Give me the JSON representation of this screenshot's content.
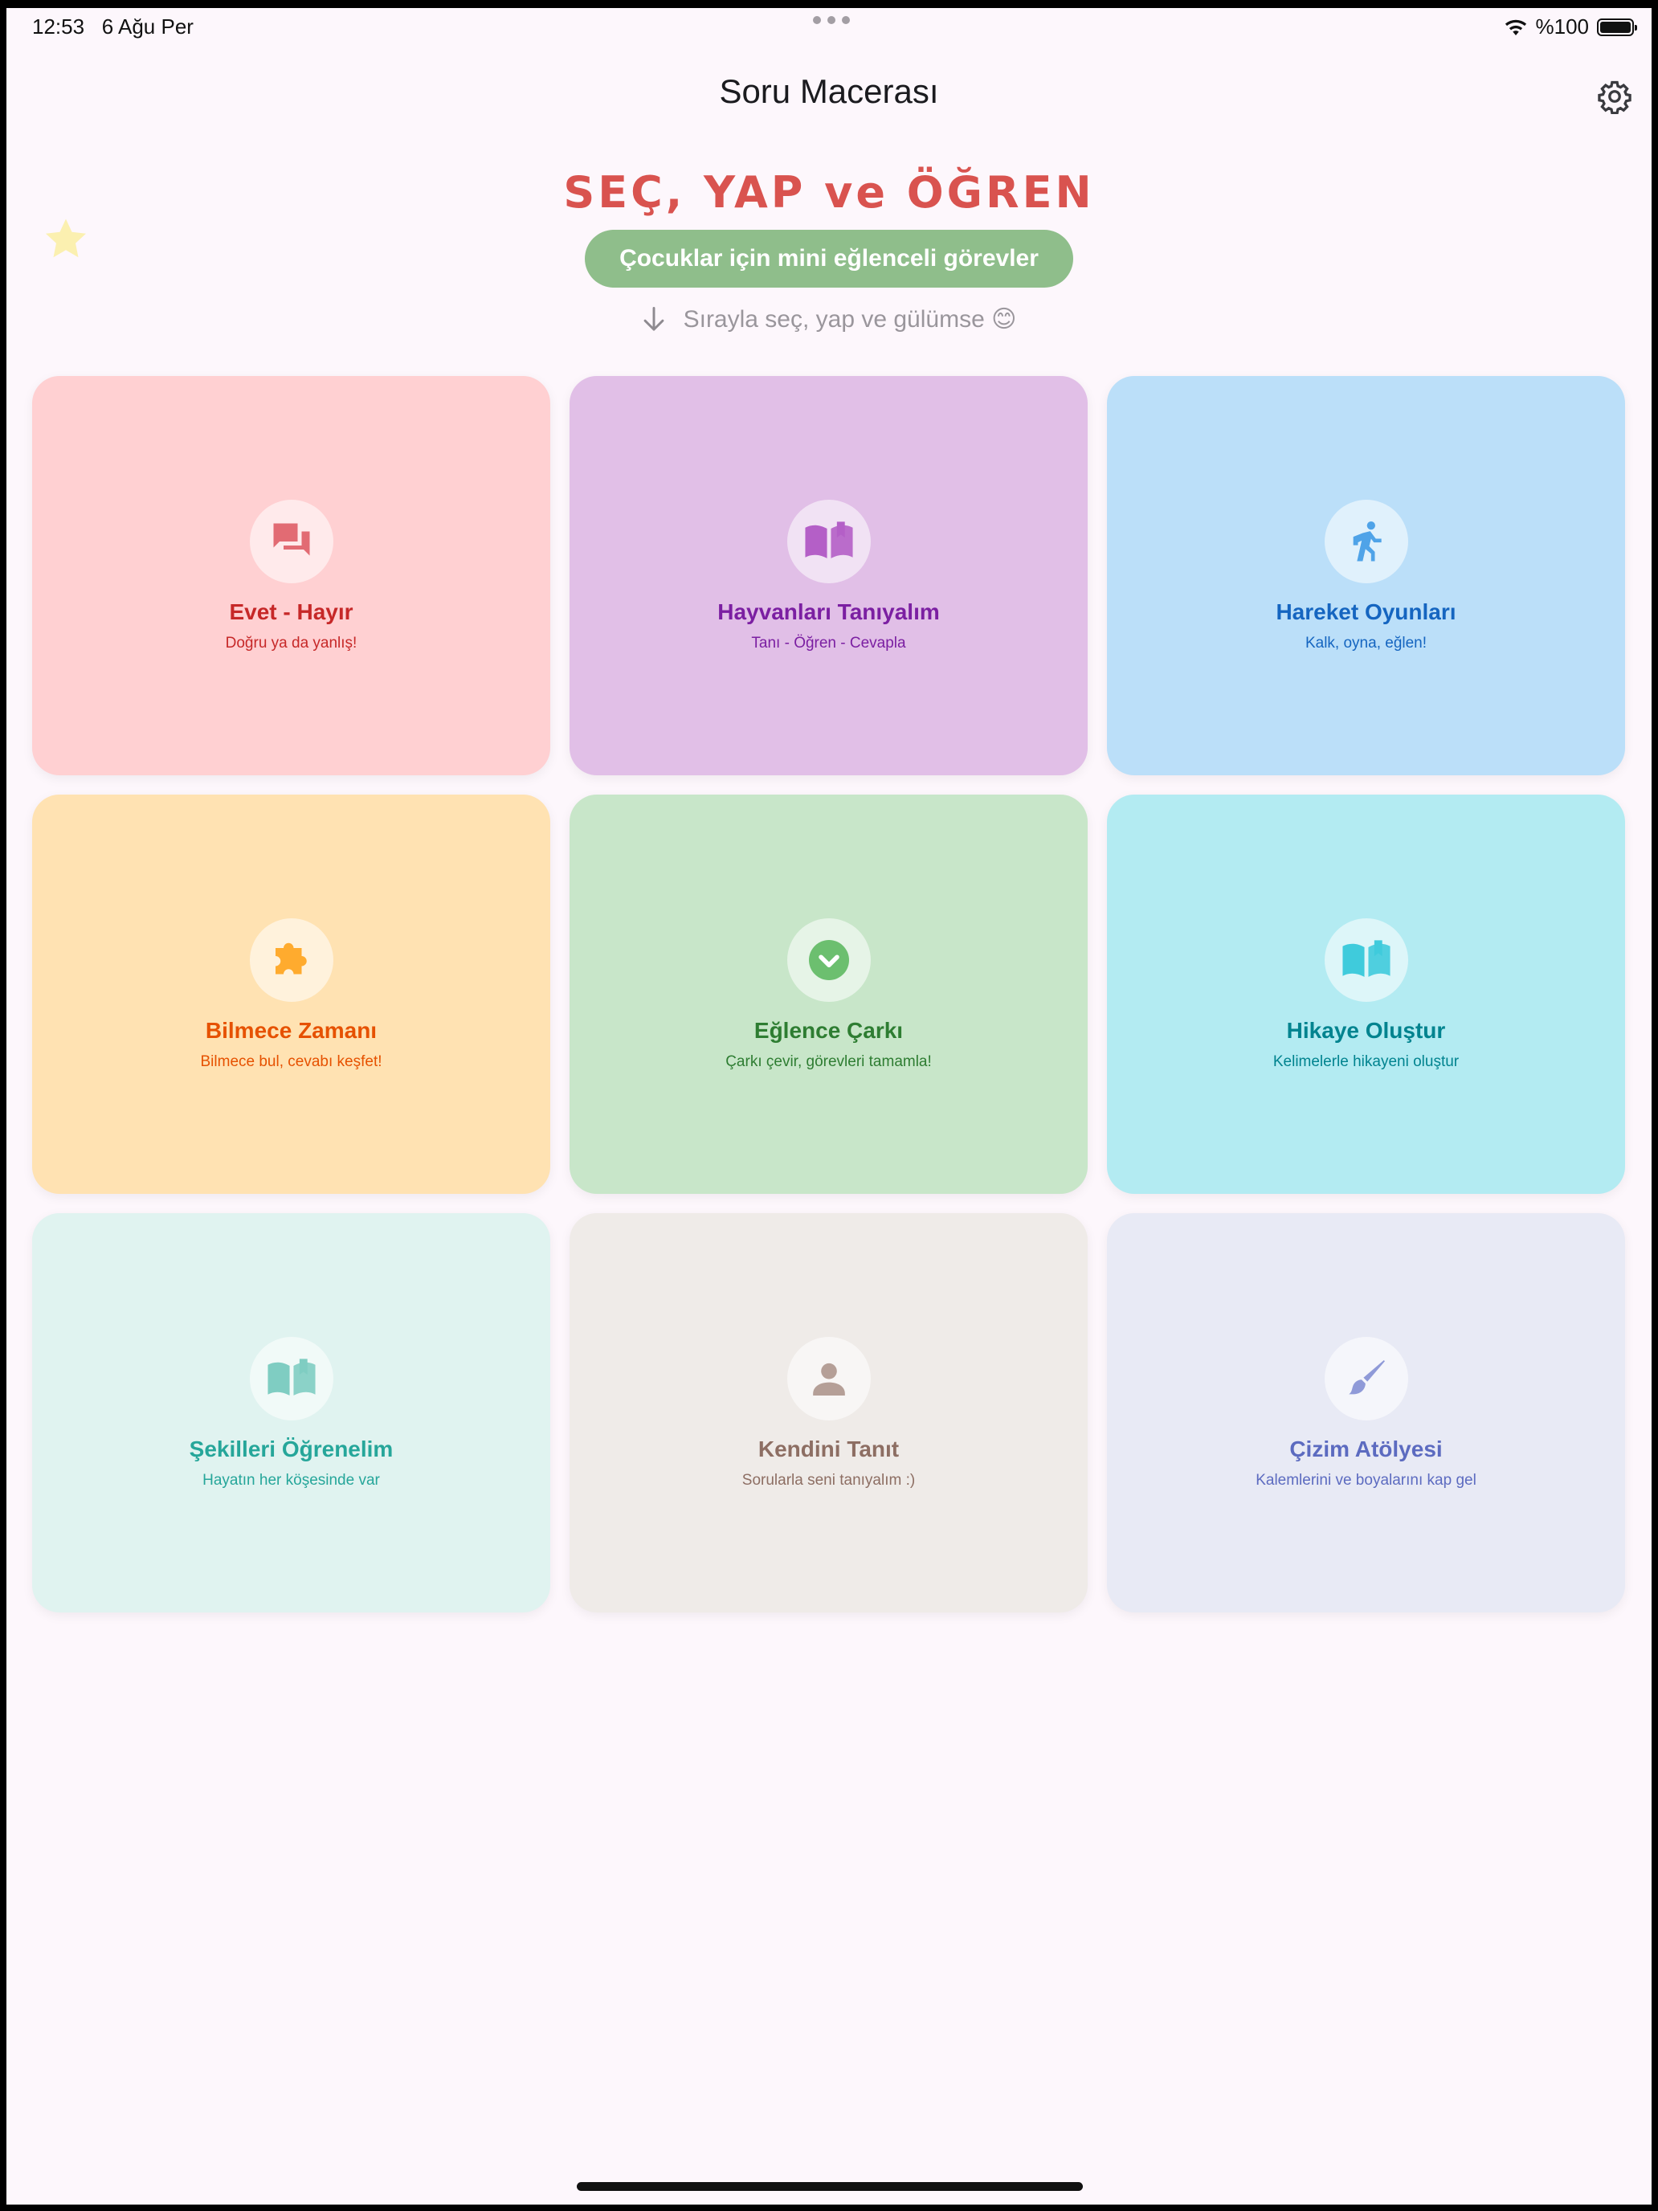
{
  "status": {
    "time": "12:53",
    "date": "6 Ağu Per",
    "battery": "%100"
  },
  "header": {
    "title": "Soru Macerası",
    "settings_icon": "gear-icon"
  },
  "hero": {
    "headline": "SEÇ, YAP ve ÖĞREN",
    "tagline": "Çocuklar için mini eğlenceli görevler",
    "hint": "Sırayla seç, yap ve gülümse 😊"
  },
  "cards": [
    {
      "title": "Evet - Hayır",
      "subtitle": "Doğru ya da yanlış!",
      "icon": "chat-bubbles-icon",
      "bg": "#ffd0d2",
      "fg": "#c62828",
      "icon_color": "#e26b73"
    },
    {
      "title": "Hayvanları Tanıyalım",
      "subtitle": "Tanı - Öğren - Cevapla",
      "icon": "book-icon",
      "bg": "#e1bfe7",
      "fg": "#7b1fa2",
      "icon_color": "#b45fc7"
    },
    {
      "title": "Hareket Oyunları",
      "subtitle": "Kalk, oyna, eğlen!",
      "icon": "running-icon",
      "bg": "#bbdff9",
      "fg": "#1565c0",
      "icon_color": "#4fa3e8"
    },
    {
      "title": "Bilmece Zamanı",
      "subtitle": "Bilmece bul, cevabı keşfet!",
      "icon": "puzzle-icon",
      "bg": "#ffe2b2",
      "fg": "#e65100",
      "icon_color": "#ffab2e"
    },
    {
      "title": "Eğlence Çarkı",
      "subtitle": "Çarkı çevir, görevleri tamamla!",
      "icon": "chevron-circle-icon",
      "bg": "#c8e6c9",
      "fg": "#2e7d32",
      "icon_color": "#6cbf6f"
    },
    {
      "title": "Hikaye Oluştur",
      "subtitle": "Kelimelerle hikayeni oluştur",
      "icon": "book-icon",
      "bg": "#b3ebf2",
      "fg": "#00838f",
      "icon_color": "#3fcbdc"
    },
    {
      "title": "Şekilleri Öğrenelim",
      "subtitle": "Hayatın her köşesinde var",
      "icon": "book-icon",
      "bg": "#e0f3f0",
      "fg": "#26a69a",
      "icon_color": "#7fcdc2"
    },
    {
      "title": "Kendini Tanıt",
      "subtitle": "Sorularla seni tanıyalım :)",
      "icon": "person-icon",
      "bg": "#efebe8",
      "fg": "#8d6e63",
      "icon_color": "#b59f97"
    },
    {
      "title": "Çizim Atölyesi",
      "subtitle": "Kalemlerini ve boyalarını kap gel",
      "icon": "brush-icon",
      "bg": "#e8eaf5",
      "fg": "#5c6bc0",
      "icon_color": "#8f9ad8"
    }
  ]
}
